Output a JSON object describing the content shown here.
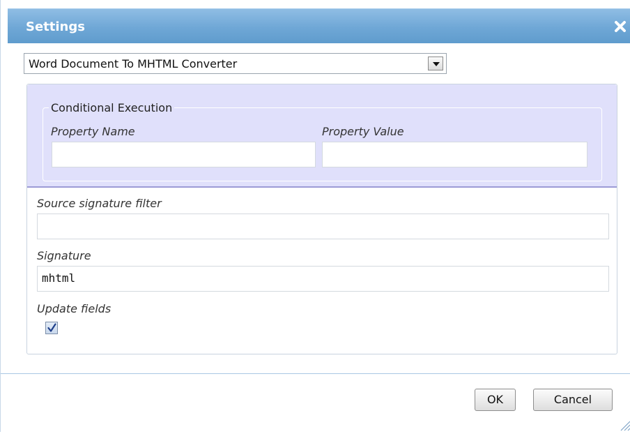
{
  "dialog": {
    "title": "Settings",
    "close_icon": "close-icon"
  },
  "converter_select": {
    "value": "Word Document To MHTML Converter"
  },
  "conditional_execution": {
    "legend": "Conditional Execution",
    "property_name_label": "Property Name",
    "property_name_value": "",
    "property_value_label": "Property Value",
    "property_value_value": ""
  },
  "source_signature_filter": {
    "label": "Source signature filter",
    "value": ""
  },
  "signature": {
    "label": "Signature",
    "value": "mhtml"
  },
  "update_fields": {
    "label": "Update fields",
    "checked": true
  },
  "footer": {
    "ok_label": "OK",
    "cancel_label": "Cancel"
  },
  "colors": {
    "titlebar": "#6fa7d6",
    "conditional_area": "#e0e0fb",
    "divider": "#a9c8e4"
  }
}
